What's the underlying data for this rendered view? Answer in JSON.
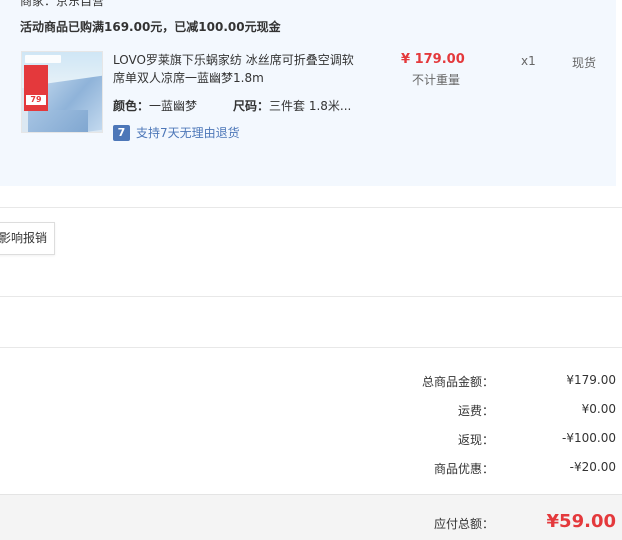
{
  "order": {
    "seller": "商家：京东自营",
    "promo": "活动商品已购满169.00元，已减100.00元现金",
    "product": {
      "name": "LOVO罗莱旗下乐蜗家纺 冰丝席可折叠空调软席单双人凉席一蓝幽梦1.8m",
      "thumb_badge": "79",
      "price": "¥ 179.00",
      "weight_note": "不计重量",
      "quantity": "x1",
      "stock": "现货",
      "color_label": "颜色：",
      "color_value": "一蓝幽梦",
      "size_label": "尺码：",
      "size_value": "三件套 1.8米...",
      "return_icon": "7",
      "return_text": "支持7天无理由退货"
    }
  },
  "invoice_button": "影响报销",
  "summary": {
    "rows": [
      {
        "label": "总商品金额：",
        "value": "¥179.00"
      },
      {
        "label": "运费：",
        "value": "¥0.00"
      },
      {
        "label": "返现：",
        "value": "-¥100.00"
      },
      {
        "label": "商品优惠：",
        "value": "-¥20.00"
      }
    ],
    "total_label": "应付总额：",
    "total_value": "¥59.00"
  },
  "colors": {
    "accent_red": "#e4393c",
    "link_blue": "#4d77b8",
    "order_bg": "#f3f8fe"
  }
}
